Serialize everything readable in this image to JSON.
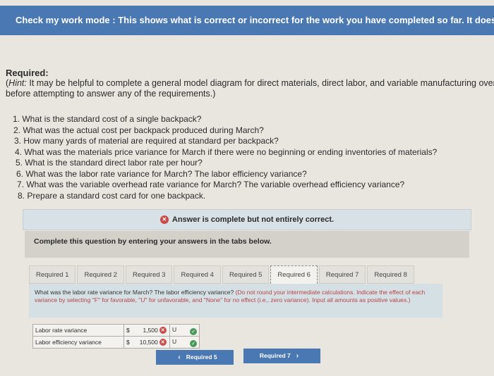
{
  "banner": {
    "text": "Check my work mode : This shows what is correct or incorrect for the work you have completed so far. It does not indica"
  },
  "required": {
    "heading": "Required:",
    "hint_label": "Hint:",
    "hint_line1": " It may be helpful to complete a general model diagram for direct materials, direct labor, and variable manufacturing overhea",
    "hint_line2": "before attempting to answer any of the requirements.)",
    "hint_open": "("
  },
  "questions": [
    "1. What is the standard cost of a single backpack?",
    "2. What was the actual cost per backpack produced during March?",
    "3. How many yards of material are required at standard per backpack?",
    "4. What was the materials price variance for March if there were no beginning or ending inventories of materials?",
    "5. What is the standard direct labor rate per hour?",
    "6. What was the labor rate variance for March? The labor efficiency variance?",
    "7. What was the variable overhead rate variance for March? The variable overhead efficiency variance?",
    "8. Prepare a standard cost card for one backpack."
  ],
  "status": {
    "icon": "x-circle-icon",
    "text": "Answer is complete but not entirely correct."
  },
  "instruction": "Complete this question by entering your answers in the tabs below.",
  "tabs": [
    {
      "label": "Required 1",
      "active": false
    },
    {
      "label": "Required 2",
      "active": false
    },
    {
      "label": "Required 3",
      "active": false
    },
    {
      "label": "Required 4",
      "active": false
    },
    {
      "label": "Required 5",
      "active": false
    },
    {
      "label": "Required 6",
      "active": true
    },
    {
      "label": "Required 7",
      "active": false
    },
    {
      "label": "Required 8",
      "active": false
    }
  ],
  "question_box": {
    "main": "What was the labor rate variance for March? The labor efficiency variance? ",
    "note": "(Do not round your intermediate calculations. Indicate the effect of each variance by selecting \"F\" for favorable, \"U\" for unfavorable, and \"None\" for no effect (i.e., zero variance). Input all amounts as positive values.)"
  },
  "answers": [
    {
      "label": "Labor rate variance",
      "currency": "$",
      "amount": "1,500",
      "amount_status": "incorrect",
      "effect": "U",
      "effect_status": "correct"
    },
    {
      "label": "Labor efficiency variance",
      "currency": "$",
      "amount": "10,500",
      "amount_status": "incorrect",
      "effect": "U",
      "effect_status": "correct"
    }
  ],
  "nav": {
    "prev_label": "Required 5",
    "next_label": "Required 7",
    "prev_icon": "chevron-left-icon",
    "next_icon": "chevron-right-icon"
  },
  "colors": {
    "banner": "#4a78b3",
    "incorrect": "#c84a4a",
    "correct": "#4a9b5b"
  }
}
